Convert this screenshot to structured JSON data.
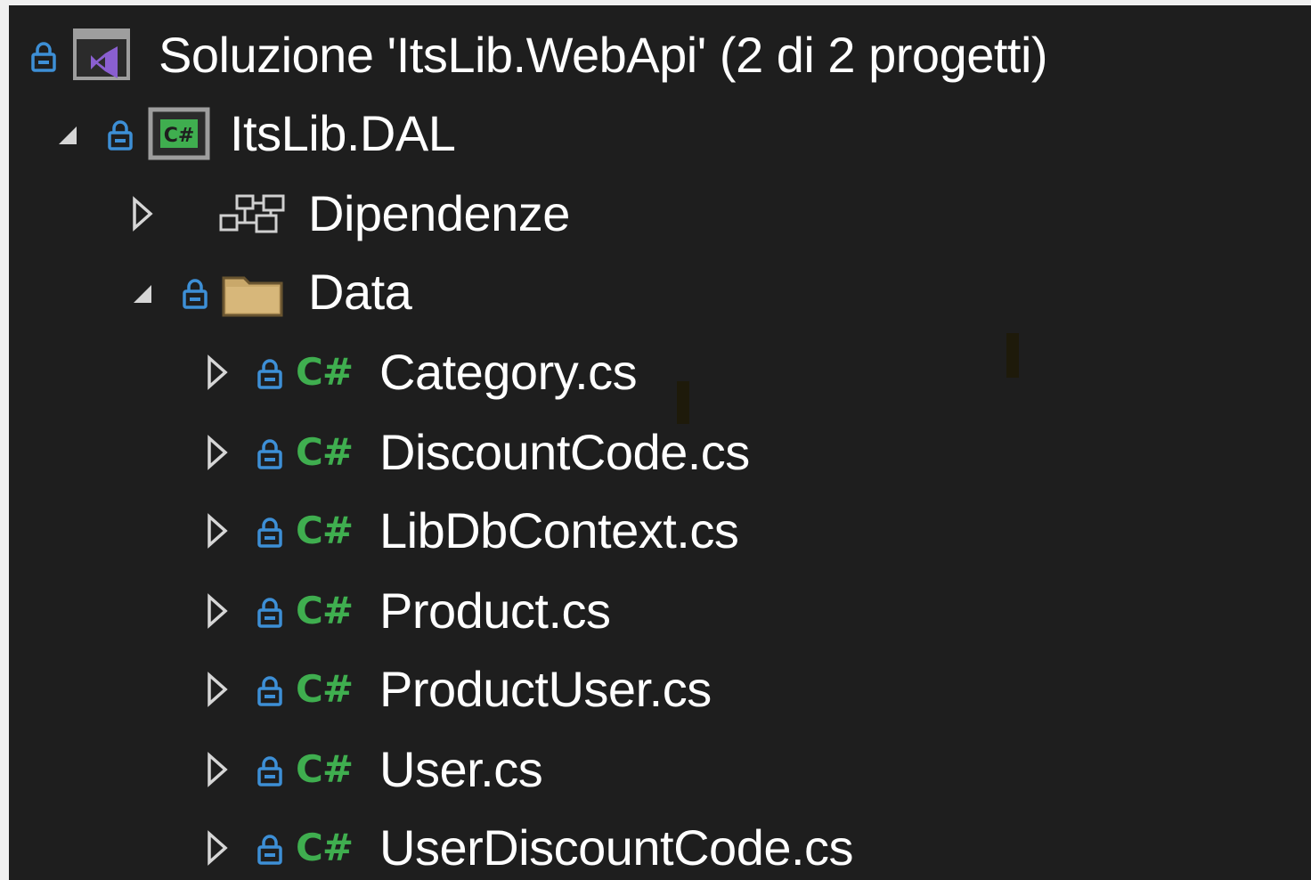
{
  "solution": {
    "label": "Soluzione 'ItsLib.WebApi' (2 di 2 progetti)"
  },
  "project": {
    "label": "ItsLib.DAL",
    "badge": "C#"
  },
  "dependencies": {
    "label": "Dipendenze"
  },
  "folder": {
    "label": "Data"
  },
  "files": [
    {
      "label": "Category.cs",
      "glyph": "C#"
    },
    {
      "label": "DiscountCode.cs",
      "glyph": "C#"
    },
    {
      "label": "LibDbContext.cs",
      "glyph": "C#"
    },
    {
      "label": "Product.cs",
      "glyph": "C#"
    },
    {
      "label": "ProductUser.cs",
      "glyph": "C#"
    },
    {
      "label": "User.cs",
      "glyph": "C#"
    },
    {
      "label": "UserDiscountCode.cs",
      "glyph": "C#"
    }
  ],
  "colors": {
    "background": "#1e1e1e",
    "lock": "#3d8fd6",
    "csharp": "#3fae4f",
    "folder": "#c9a86a",
    "vs_purple": "#8a5fd0"
  },
  "icons": {
    "lock": "lock-icon",
    "expanded": "expanded-arrow-icon",
    "collapsed": "collapsed-arrow-icon",
    "solution": "solution-icon",
    "project": "csharp-project-icon",
    "dependencies": "dependencies-icon",
    "folder": "folder-icon",
    "csharp_file": "csharp-file-icon"
  }
}
